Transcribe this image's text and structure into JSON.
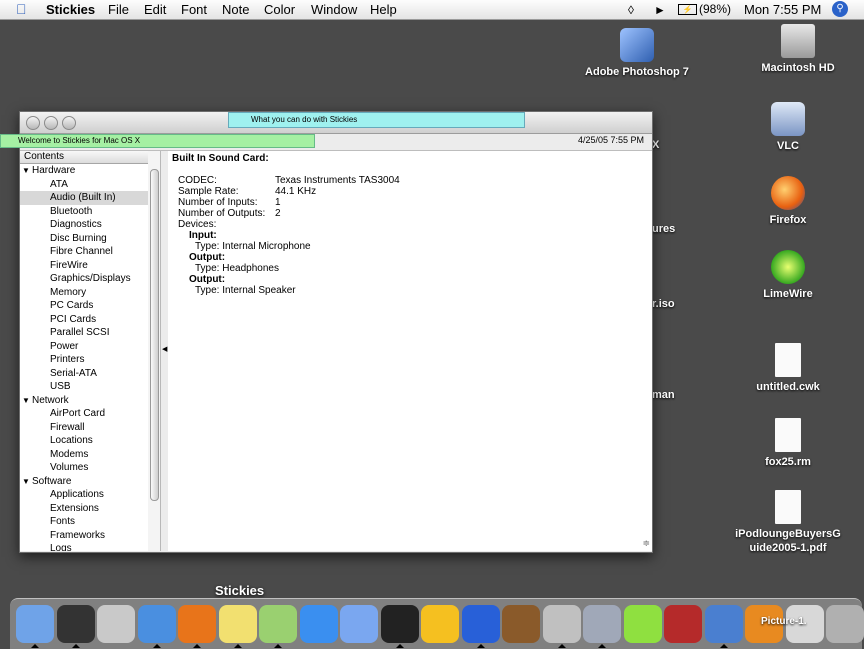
{
  "menubar": {
    "app": "Stickies",
    "items": [
      "File",
      "Edit",
      "Font",
      "Note",
      "Color",
      "Window",
      "Help"
    ],
    "battery": "(98%)",
    "clock": "Mon 7:55 PM"
  },
  "desktop": {
    "icons": [
      {
        "label": "Adobe Photoshop 7",
        "icon": "photoshop-icon"
      },
      {
        "label": "Macintosh HD",
        "icon": "hard-drive-icon"
      },
      {
        "label": "VLC",
        "icon": "vlc-icon"
      },
      {
        "label": "Firefox",
        "icon": "firefox-icon"
      },
      {
        "label": "LimeWire",
        "icon": "limewire-icon"
      },
      {
        "label": "untitled.cwk",
        "icon": "document-icon"
      },
      {
        "label": "fox25.rm",
        "icon": "realmedia-icon"
      },
      {
        "label": "iPodloungeBuyersGuide2005-1.pdf",
        "icon": "pdf-icon"
      }
    ],
    "partial_labels": [
      "X",
      "ures",
      "r.iso",
      "man"
    ]
  },
  "stickies": {
    "note1": "What you can do with Stickies",
    "note2": "Welcome to Stickies for Mac OS X"
  },
  "window": {
    "date": "4/25/05 7:55 PM",
    "contents_header": "Contents",
    "tree": [
      {
        "label": "Hardware",
        "group": true
      },
      {
        "label": "ATA"
      },
      {
        "label": "Audio (Built In)",
        "selected": true
      },
      {
        "label": "Bluetooth"
      },
      {
        "label": "Diagnostics"
      },
      {
        "label": "Disc Burning"
      },
      {
        "label": "Fibre Channel"
      },
      {
        "label": "FireWire"
      },
      {
        "label": "Graphics/Displays"
      },
      {
        "label": "Memory"
      },
      {
        "label": "PC Cards"
      },
      {
        "label": "PCI Cards"
      },
      {
        "label": "Parallel SCSI"
      },
      {
        "label": "Power"
      },
      {
        "label": "Printers"
      },
      {
        "label": "Serial-ATA"
      },
      {
        "label": "USB"
      },
      {
        "label": "Network",
        "group": true
      },
      {
        "label": "AirPort Card"
      },
      {
        "label": "Firewall"
      },
      {
        "label": "Locations"
      },
      {
        "label": "Modems"
      },
      {
        "label": "Volumes"
      },
      {
        "label": "Software",
        "group": true
      },
      {
        "label": "Applications"
      },
      {
        "label": "Extensions"
      },
      {
        "label": "Fonts"
      },
      {
        "label": "Frameworks"
      },
      {
        "label": "Logs"
      }
    ],
    "detail": {
      "title": "Built In Sound Card:",
      "rows": [
        {
          "k": "CODEC:",
          "v": "Texas Instruments TAS3004"
        },
        {
          "k": "Sample Rate:",
          "v": "44.1 KHz"
        },
        {
          "k": "Number of Inputs:",
          "v": "1"
        },
        {
          "k": "Number of Outputs:",
          "v": "2"
        },
        {
          "k": "Devices:",
          "v": ""
        }
      ],
      "input_label": "Input:",
      "input_type": "Type:  Internal Microphone",
      "output1_label": "Output:",
      "output1_type": "Type:  Headphones",
      "output2_label": "Output:",
      "output2_type": "Type:  Internal Speaker"
    }
  },
  "dock": {
    "label": "Stickies",
    "picture_label": "Picture-1.",
    "items": [
      "finder-icon",
      "dashboard-icon",
      "system-preferences-icon",
      "safari-icon",
      "firefox-icon",
      "stickies-icon",
      "itunes-icon",
      "quicktime-icon",
      "ichat-icon",
      "terminal-icon",
      "aim-icon",
      "frog-icon",
      "book-icon",
      "dvd-icon",
      "preview-icon",
      "limewire-icon",
      "dictionary-icon",
      "system-profiler-icon",
      "vlc-icon",
      "picture-icon",
      "trash-icon"
    ]
  },
  "colors": {
    "desktop": "#4a4a4a",
    "sticky_cyan": "#9ff1ef",
    "sticky_green": "#a5f0a3",
    "accent": "#2a62c9"
  }
}
